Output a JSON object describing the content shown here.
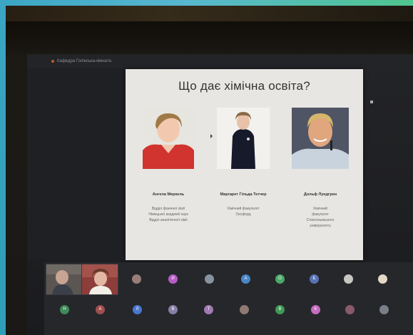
{
  "window": {
    "title": "Кафедра Голінська-кімнатa"
  },
  "slide": {
    "title": "Що дає хімічна освіта?",
    "people": [
      {
        "name": "Ангела Меркель",
        "lines": [
          "Відділ фізичної хімії",
          "Німецької академії наук",
          "Відділ аналітичної хімії"
        ]
      },
      {
        "name": "Маргарет Гільда Тетчер",
        "lines": [
          "Хімічний факультет",
          "Оксфорд"
        ]
      },
      {
        "name": "Дольф Лундгрен",
        "lines": [
          "Хімічний",
          "факультет",
          "Стокгольмського",
          "університету"
        ]
      }
    ]
  },
  "participants": {
    "row1": [
      {
        "initial": "",
        "color": "#9a7d78"
      },
      {
        "initial": "И",
        "color": "#b85cc8"
      },
      {
        "initial": "",
        "color": "#8893a0"
      },
      {
        "initial": "А",
        "color": "#4a86c8"
      },
      {
        "initial": "О",
        "color": "#4aa86a"
      },
      {
        "initial": "Б",
        "color": "#5a73b5"
      },
      {
        "initial": "",
        "color": "#c9c7c2"
      },
      {
        "initial": "",
        "color": "#e3d8c6"
      }
    ],
    "row2": [
      {
        "initial": "Н",
        "color": "#3f8a5a"
      },
      {
        "initial": "А",
        "color": "#a04e4e"
      },
      {
        "initial": "Л",
        "color": "#4a78d0"
      },
      {
        "initial": "В",
        "color": "#8a7fa8"
      },
      {
        "initial": "Т",
        "color": "#a07ab0"
      },
      {
        "initial": "",
        "color": "#8e7a72"
      },
      {
        "initial": "В",
        "color": "#3f9a55"
      },
      {
        "initial": "К",
        "color": "#c56bc0"
      },
      {
        "initial": "",
        "color": "#8a5a6a"
      },
      {
        "initial": "",
        "color": "#7a7e88"
      }
    ]
  }
}
